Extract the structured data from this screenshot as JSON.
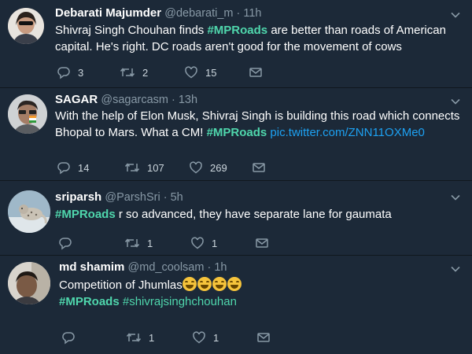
{
  "tweets": [
    {
      "name": "Debarati Majumder",
      "handle": "@debarati_m · 11h",
      "body_line1_pre": "Shivraj Singh Chouhan finds ",
      "body_line1_tag": "#MPRoads",
      "body_line1_post": " are better than roads of American",
      "body_line2": "capital. He's right. DC roads aren't good for the movement of cows",
      "replies": "3",
      "retweets": "2",
      "likes": "15"
    },
    {
      "name": "SAGAR",
      "handle": "@sagarcasm · 13h",
      "body_line1": "With the help of Elon Musk, Shivraj Singh is building this road which connects",
      "body_line2_pre": "Bhopal to Mars. What a CM! ",
      "body_line2_tag": "#MPRoads",
      "body_line2_link": " pic.twitter.com/ZNN11OXMe0",
      "replies": "14",
      "retweets": "107",
      "likes": "269"
    },
    {
      "name": "sriparsh",
      "handle": "@ParshSri · 5h",
      "body_tag": "#MPRoads",
      "body_post": " r so advanced, they have separate lane for gaumata",
      "retweets": "1",
      "likes": "1"
    },
    {
      "name": "md shamim",
      "handle": "@md_coolsam · 1h",
      "body_line1": "Competition of Jhumlas",
      "body_tag1": "#MPRoads",
      "body_tag2": " #shivrajsinghchouhan",
      "retweets": "1",
      "likes": "1"
    }
  ],
  "colors": {
    "background": "#1c2938",
    "hashtag": "#4fd6ac",
    "link": "#1da1f2",
    "secondary": "#8899a6"
  },
  "icons": [
    "reply-icon",
    "retweet-icon",
    "like-icon",
    "message-icon",
    "chevron-down-icon",
    "joy-emoji"
  ]
}
